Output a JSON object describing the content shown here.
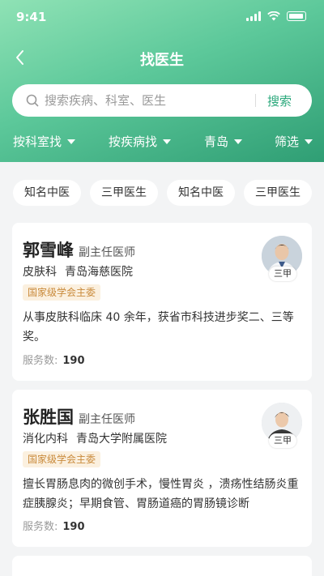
{
  "status": {
    "time": "9:41"
  },
  "nav": {
    "title": "找医生"
  },
  "search": {
    "placeholder": "搜索疾病、科室、医生",
    "button": "搜索"
  },
  "filters": [
    "按科室找",
    "按疾病找",
    "青岛",
    "筛选"
  ],
  "chips": [
    "知名中医",
    "三甲医生",
    "知名中医",
    "三甲医生"
  ],
  "served_label": "服务数:",
  "doctors": [
    {
      "name": "郭雪峰",
      "title": "副主任医师",
      "dept": "皮肤科",
      "hospital": "青岛海慈医院",
      "tag": "国家级学会主委",
      "intro": "从事皮肤科临床 40 余年，获省市科技进步奖二、三等奖。",
      "served": "190",
      "avatar_badge": "三甲"
    },
    {
      "name": "张胜国",
      "title": "副主任医师",
      "dept": "消化内科",
      "hospital": "青岛大学附属医院",
      "tag": "国家级学会主委",
      "intro": "擅长胃肠息肉的微创手术，慢性胃炎 ，溃疡性结肠炎重症胰腺炎；早期食管、胃肠道癌的胃肠镜诊断",
      "served": "190",
      "avatar_badge": "三甲"
    }
  ],
  "colors": {
    "accent": "#2aa87b",
    "header_start": "#8fe2b5",
    "header_end": "#2f9e74",
    "tag_bg": "#fbf0df",
    "tag_text": "#c98a3b"
  },
  "icons": {
    "back": "chevron-left-icon",
    "search": "search-icon",
    "caret": "caret-down-icon"
  }
}
